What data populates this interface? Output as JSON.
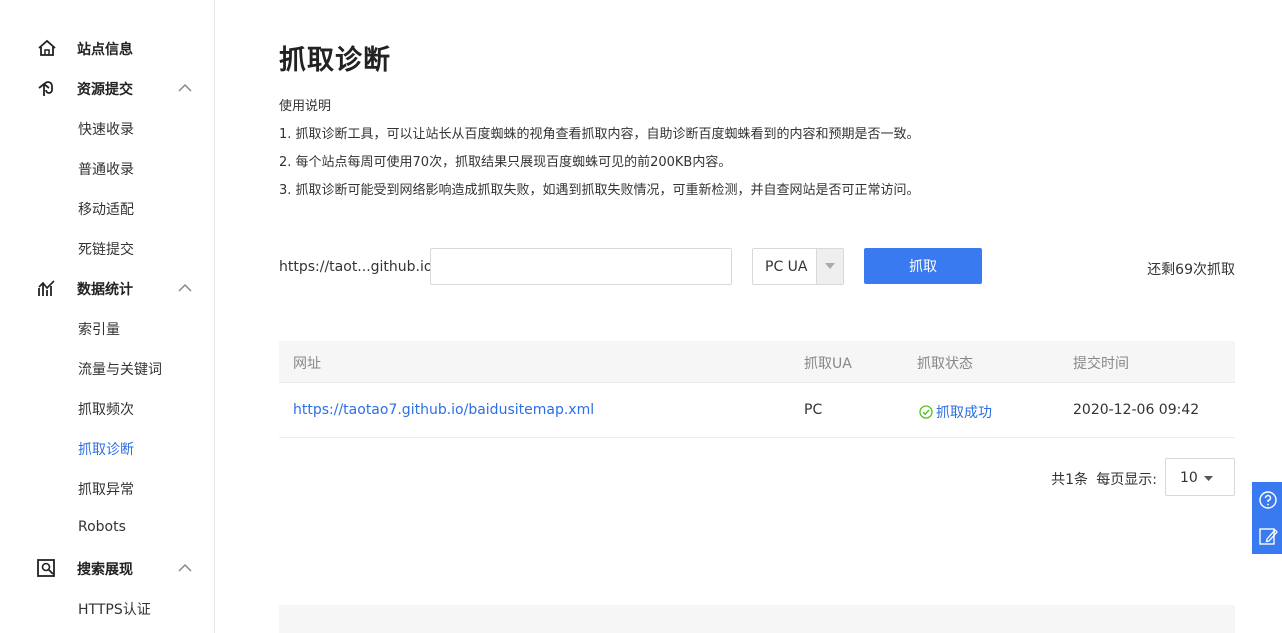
{
  "sidebar": {
    "groups": [
      {
        "label": "站点信息",
        "icon": "home-icon"
      },
      {
        "label": "资源提交",
        "icon": "submit-icon",
        "items": [
          "快速收录",
          "普通收录",
          "移动适配",
          "死链提交"
        ]
      },
      {
        "label": "数据统计",
        "icon": "stats-icon",
        "items": [
          "索引量",
          "流量与关键词",
          "抓取频次",
          "抓取诊断",
          "抓取异常",
          "Robots"
        ]
      },
      {
        "label": "搜索展现",
        "icon": "search-display-icon",
        "items": [
          "HTTPS认证"
        ]
      }
    ],
    "active_item": "抓取诊断"
  },
  "main": {
    "title": "抓取诊断",
    "instructions": [
      "使用说明",
      "1. 抓取诊断工具，可以让站长从百度蜘蛛的视角查看抓取内容，自助诊断百度蜘蛛看到的内容和预期是否一致。",
      "2. 每个站点每周可使用70次，抓取结果只展现百度蜘蛛可见的前200KB内容。",
      "3. 抓取诊断可能受到网络影响造成抓取失败，如遇到抓取失败情况，可重新检测，并自查网站是否可正常访问。"
    ],
    "form": {
      "url_prefix": "https://taot...github.io/",
      "url_value": "",
      "ua_selected": "PC UA",
      "fetch_label": "抓取",
      "remaining": "还剩69次抓取"
    },
    "table": {
      "headers": [
        "网址",
        "抓取UA",
        "抓取状态",
        "提交时间"
      ],
      "rows": [
        {
          "url": "https://taotao7.github.io/baidusitemap.xml",
          "ua": "PC",
          "status": "抓取成功",
          "time": "2020-12-06 09:42"
        }
      ]
    },
    "pager": {
      "total": "共1条",
      "per_page_label": "每页显示:",
      "per_page_value": "10"
    }
  },
  "colors": {
    "accent": "#3a7af0",
    "link": "#2c6fe6",
    "success": "#52c41a"
  },
  "float_bar": [
    "help-icon",
    "feedback-icon"
  ]
}
